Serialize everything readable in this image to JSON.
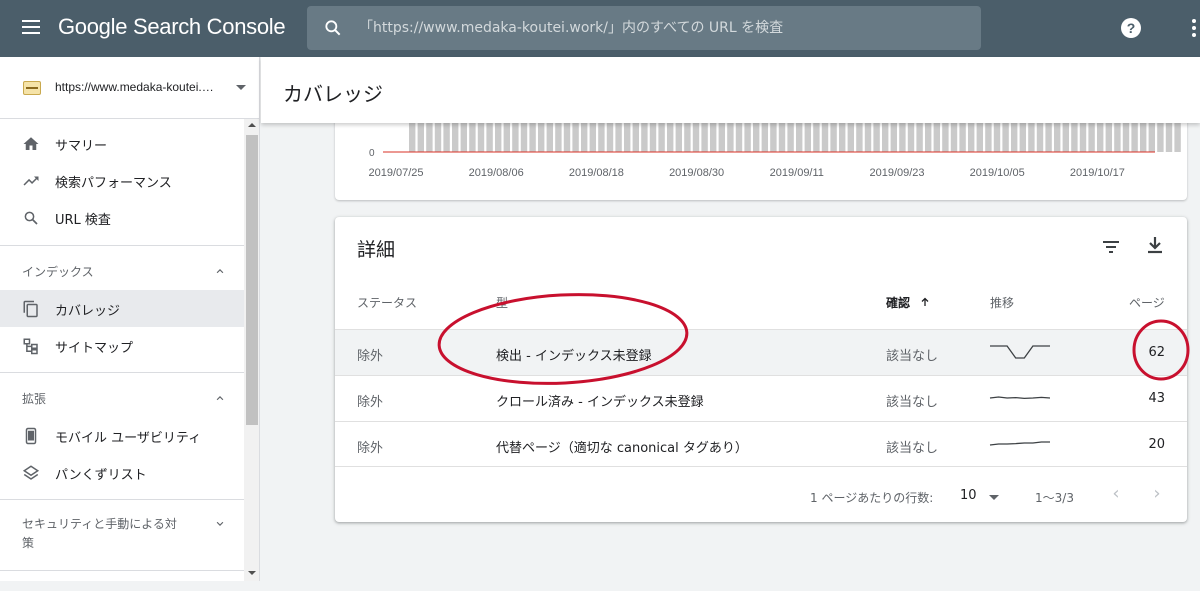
{
  "app": {
    "title": "Google Search Console"
  },
  "search": {
    "placeholder": "「https://www.medaka-koutei.work/」内のすべての URL を検査"
  },
  "property": {
    "url": "https://www.medaka-koutei.work/"
  },
  "sidebar": {
    "items": [
      {
        "label": "サマリー",
        "icon": "home-icon"
      },
      {
        "label": "検索パフォーマンス",
        "icon": "trending-up-icon"
      },
      {
        "label": "URL 検査",
        "icon": "search-icon"
      }
    ],
    "index_section": {
      "label": "インデックス",
      "items": [
        {
          "label": "カバレッジ",
          "icon": "file-copy-icon",
          "active": true
        },
        {
          "label": "サイトマップ",
          "icon": "sitemap-icon"
        }
      ]
    },
    "enhancements_section": {
      "label": "拡張",
      "items": [
        {
          "label": "モバイル ユーザビリティ",
          "icon": "smartphone-icon"
        },
        {
          "label": "パンくずリスト",
          "icon": "layers-icon"
        }
      ]
    },
    "security_section": {
      "label": "セキュリティと手動による対策"
    }
  },
  "page": {
    "title": "カバレッジ"
  },
  "chart": {
    "y_zero_label": "0",
    "x_labels": [
      "2019/07/25",
      "2019/08/06",
      "2019/08/18",
      "2019/08/30",
      "2019/09/11",
      "2019/09/23",
      "2019/10/05",
      "2019/10/17"
    ]
  },
  "details": {
    "title": "詳細",
    "columns": {
      "status": "ステータス",
      "type": "型",
      "validation": "確認",
      "trend": "推移",
      "pages": "ページ"
    },
    "rows": [
      {
        "status": "除外",
        "type": "検出 - インデックス未登録",
        "validation": "該当なし",
        "pages": "62",
        "trend": [
          0.8,
          0.8,
          0.8,
          0.2,
          0.2,
          0.8,
          0.8,
          0.8
        ]
      },
      {
        "status": "除外",
        "type": "クロール済み - インデックス未登録",
        "validation": "該当なし",
        "pages": "43",
        "trend": [
          0.5,
          0.55,
          0.5,
          0.52,
          0.48,
          0.5,
          0.53,
          0.5
        ]
      },
      {
        "status": "除外",
        "type": "代替ページ（適切な canonical タグあり）",
        "validation": "該当なし",
        "pages": "20",
        "trend": [
          0.45,
          0.5,
          0.5,
          0.52,
          0.55,
          0.55,
          0.6,
          0.6
        ]
      }
    ],
    "footer": {
      "rows_per_page_label": "1 ページあたりの行数:",
      "rows_per_page": "10",
      "range": "1〜3/3"
    }
  },
  "colors": {
    "topbar": "#4b5e6a",
    "annotation": "#c8102e",
    "excluded_series": "#9e9e9e",
    "error_line": "#d93025"
  }
}
